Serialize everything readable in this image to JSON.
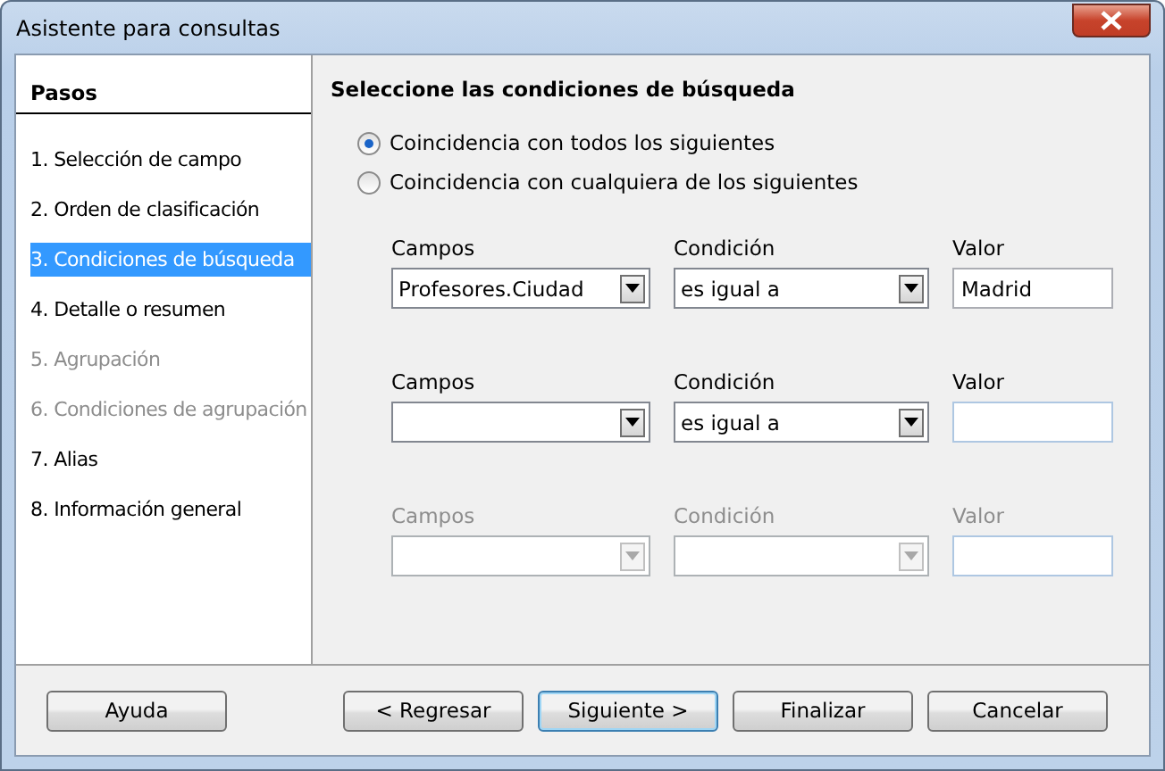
{
  "window": {
    "title": "Asistente para consultas"
  },
  "steps_panel": {
    "heading": "Pasos",
    "items": [
      {
        "label": "1. Selección de campo",
        "selected": false,
        "disabled": false
      },
      {
        "label": "2. Orden de clasificación",
        "selected": false,
        "disabled": false
      },
      {
        "label": "3. Condiciones de búsqueda",
        "selected": true,
        "disabled": false
      },
      {
        "label": "4. Detalle o resumen",
        "selected": false,
        "disabled": false
      },
      {
        "label": "5. Agrupación",
        "selected": false,
        "disabled": true
      },
      {
        "label": "6. Condiciones de agrupación",
        "selected": false,
        "disabled": true
      },
      {
        "label": "7. Alias",
        "selected": false,
        "disabled": false
      },
      {
        "label": "8. Información general",
        "selected": false,
        "disabled": false
      }
    ]
  },
  "page": {
    "heading": "Seleccione las condiciones de búsqueda",
    "match_options": [
      {
        "label": "Coincidencia con todos los siguientes",
        "selected": true
      },
      {
        "label": "Coincidencia con cualquiera de los siguientes",
        "selected": false
      }
    ],
    "conditions": [
      {
        "disabled": false,
        "field_label": "Campos",
        "field_value": "Profesores.Ciudad",
        "condition_label": "Condición",
        "condition_value": "es igual a",
        "value_label": "Valor",
        "value": "Madrid"
      },
      {
        "disabled": false,
        "field_label": "Campos",
        "condition_label": "Condición",
        "condition_value": "es igual a",
        "value_label": "Valor"
      },
      {
        "disabled": true,
        "field_label": "Campos",
        "condition_label": "Condición",
        "value_label": "Valor"
      }
    ]
  },
  "buttons": [
    {
      "label": "Ayuda",
      "default": false
    },
    {
      "label": "< Regresar",
      "default": false
    },
    {
      "label": "Siguiente >",
      "default": true
    },
    {
      "label": "Finalizar",
      "default": false
    },
    {
      "label": "Cancelar",
      "default": false
    }
  ]
}
